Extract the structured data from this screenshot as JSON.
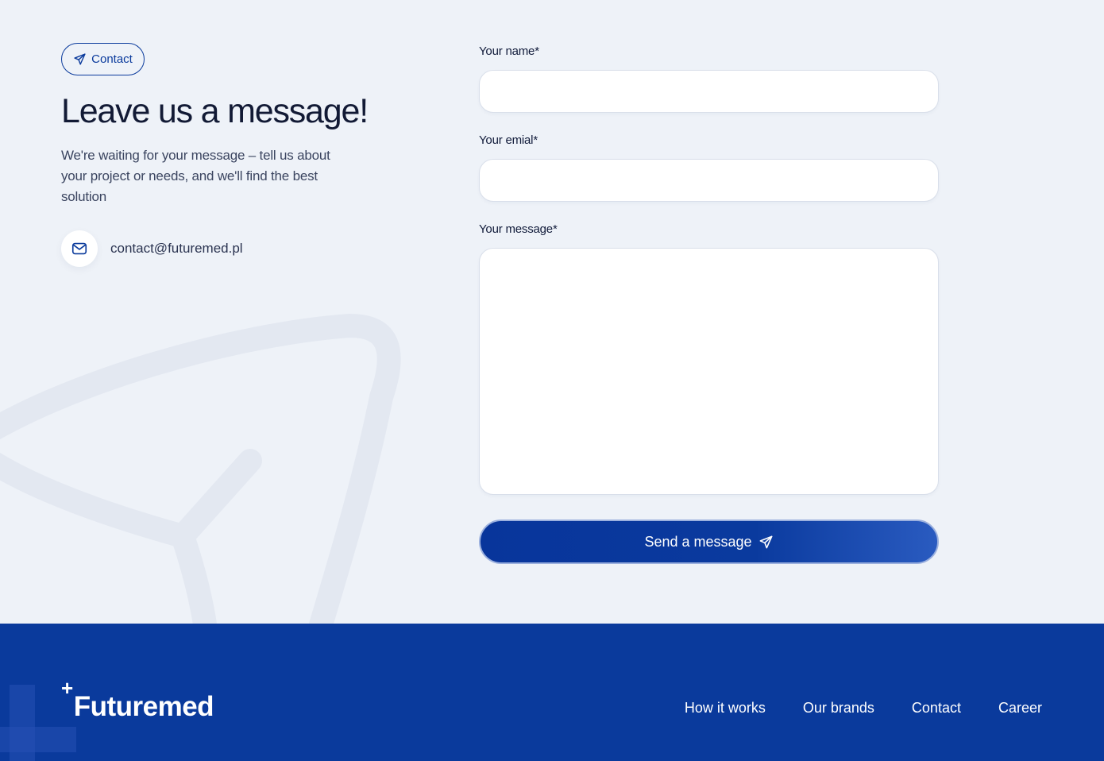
{
  "contact_section": {
    "tag_label": "Contact",
    "title": "Leave us a message!",
    "subtitle": "We're waiting for your message – tell us about your project or needs, and we'll find the best solution",
    "email": "contact@futuremed.pl"
  },
  "form": {
    "name_label": "Your name*",
    "name_value": "",
    "email_label": "Your emial*",
    "email_value": "",
    "message_label": "Your message*",
    "message_value": "",
    "submit_label": "Send a message"
  },
  "footer": {
    "logo_plus": "+",
    "logo_text": "Futuremed",
    "nav": [
      {
        "label": "How it works"
      },
      {
        "label": "Our brands"
      },
      {
        "label": "Contact"
      },
      {
        "label": "Career"
      }
    ]
  },
  "colors": {
    "background": "#eef2f8",
    "brand_blue": "#0a3a9c",
    "text_dark": "#121a35"
  },
  "icons": {
    "tag_icon": "send-icon",
    "email_icon": "mail-icon",
    "submit_icon": "send-icon"
  }
}
